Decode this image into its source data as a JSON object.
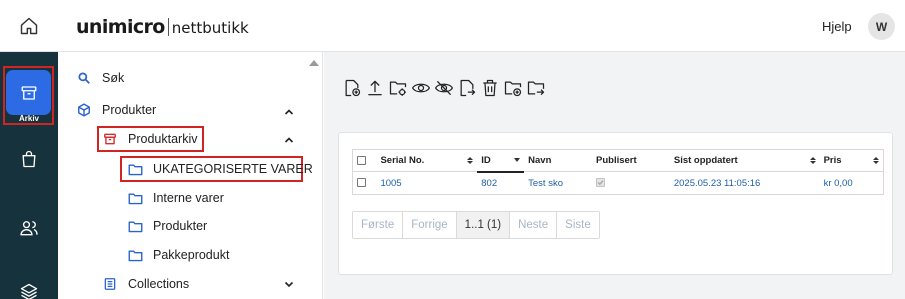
{
  "header": {
    "brand": "unimicro",
    "product": "nettbutikk",
    "help_label": "Hjelp",
    "avatar_initial": "W"
  },
  "rail": {
    "active_label": "Arkiv",
    "items": [
      "bag-icon",
      "users-icon",
      "layers-icon"
    ]
  },
  "tree": {
    "search_label": "Søk",
    "products_label": "Produkter",
    "archive_label": "Produktarkiv",
    "children": [
      "UKATEGORISERTE VARER",
      "Interne varer",
      "Produkter",
      "Pakkeprodukt"
    ],
    "collections_label": "Collections"
  },
  "toolbar": {
    "icons": [
      "new-file-icon",
      "upload-icon",
      "folder-settings-icon",
      "show-icon",
      "hide-icon",
      "move-file-icon",
      "delete-icon",
      "new-folder-icon",
      "move-folder-icon"
    ]
  },
  "table": {
    "columns": [
      "Serial No.",
      "ID",
      "Navn",
      "Publisert",
      "Sist oppdatert",
      "Pris"
    ],
    "rows": [
      {
        "serial": "1005",
        "id": "802",
        "name": "Test sko",
        "published": true,
        "updated": "2025.05.23 11:05:16",
        "price": "kr 0,00"
      }
    ]
  },
  "pager": {
    "first": "Første",
    "prev": "Forrige",
    "current": "1..1 (1)",
    "next": "Neste",
    "last": "Siste"
  },
  "colors": {
    "rail": "#16323c",
    "active": "#2d6be4",
    "highlight": "#d32424",
    "link": "#1f5fa8"
  }
}
